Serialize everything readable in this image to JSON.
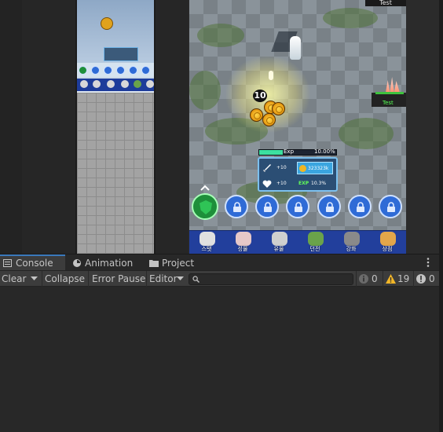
{
  "game": {
    "test_top": "Test",
    "test_right": "Test",
    "hit_number": "10",
    "exp_label": "Exp",
    "exp_percent": "10.00%",
    "attack_bonus": "+10",
    "health_bonus": "+10",
    "gold_value": "323323k",
    "exp_tag": "EXP",
    "exp_bonus": "10.3%",
    "colors": {
      "accent": "#3a79bb",
      "menu_bar": "#223f9c",
      "slot_blue": "#2f6bd6",
      "exp_fill": "#3ce0a0"
    }
  },
  "menu": [
    {
      "label": "스탯",
      "icon": "character-icon",
      "color": "#e0e0e0"
    },
    {
      "label": "성물",
      "icon": "relic-icon",
      "color": "#e6c8c8"
    },
    {
      "label": "유물",
      "icon": "artifact-icon",
      "color": "#cfcfcf"
    },
    {
      "label": "던전",
      "icon": "dungeon-icon",
      "color": "#6aa34a"
    },
    {
      "label": "강화",
      "icon": "upgrade-hammer-icon",
      "color": "#8a8a8a"
    },
    {
      "label": "상점",
      "icon": "shop-bag-icon",
      "color": "#e3a64a"
    }
  ],
  "tabs": [
    {
      "label": "Console",
      "icon": "console-icon"
    },
    {
      "label": "Animation",
      "icon": "animation-icon"
    },
    {
      "label": "Project",
      "icon": "folder-icon"
    }
  ],
  "toolbar": {
    "clear_label": "Clear",
    "collapse_label": "Collapse",
    "error_pause_label": "Error Pause",
    "editor_label": "Editor",
    "search_placeholder": "",
    "info_count": "0",
    "warning_count": "19",
    "error_count": "0"
  }
}
